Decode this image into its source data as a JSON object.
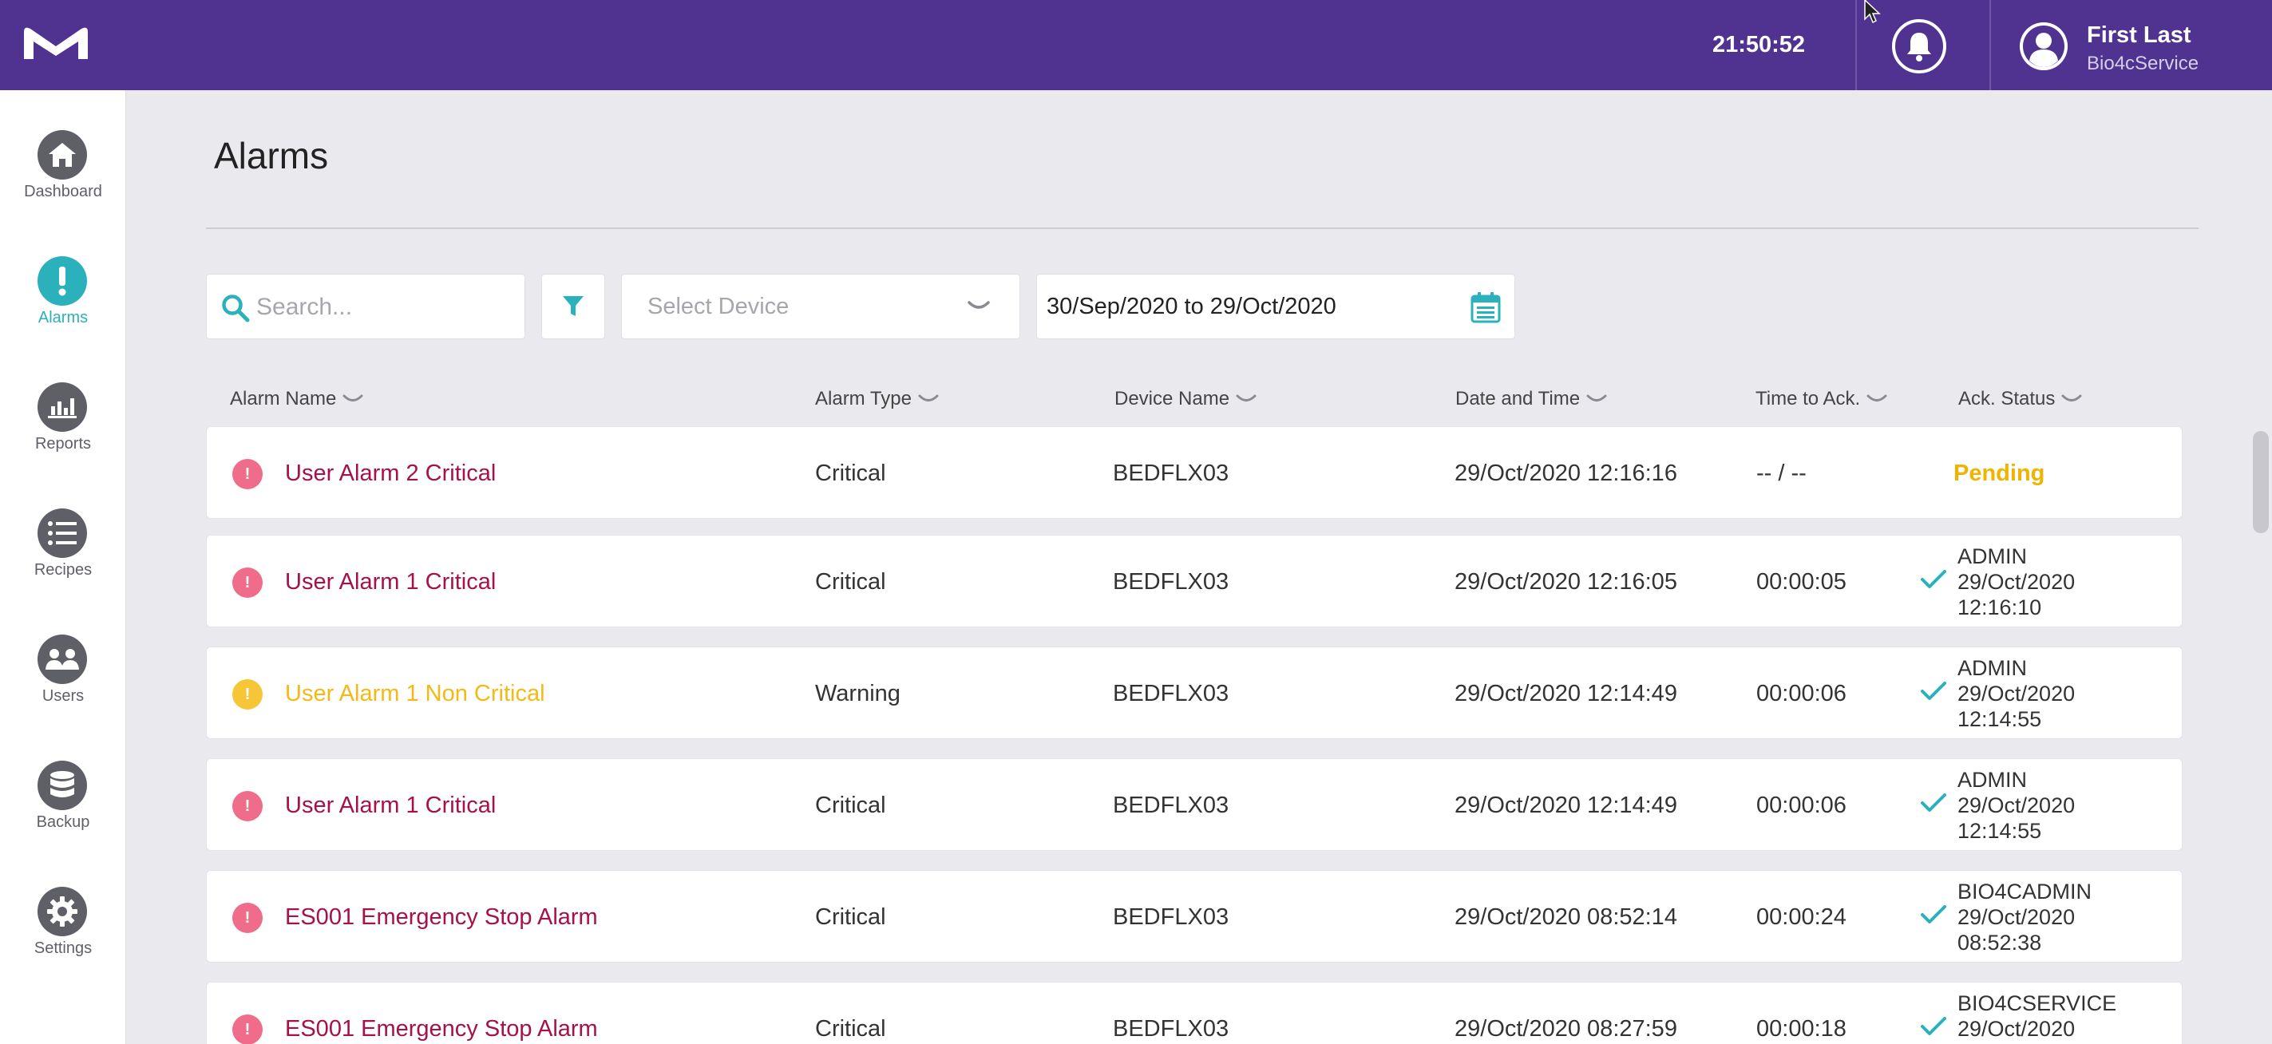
{
  "topbar": {
    "clock": "21:50:52",
    "user": {
      "name": "First Last",
      "role": "Bio4cService"
    }
  },
  "colors": {
    "brand_purple": "#503291",
    "accent_teal": "#2bb1bb",
    "critical": "#a6114a",
    "critical_dot": "#ef6d8a",
    "warning": "#f5b915",
    "warning_dot": "#f7c636",
    "pending": "#f0b400"
  },
  "sidebar": {
    "items": [
      {
        "label": "Dashboard",
        "icon": "home-icon",
        "active": false
      },
      {
        "label": "Alarms",
        "icon": "alert-icon",
        "active": true
      },
      {
        "label": "Reports",
        "icon": "chart-icon",
        "active": false
      },
      {
        "label": "Recipes",
        "icon": "list-icon",
        "active": false
      },
      {
        "label": "Users",
        "icon": "users-icon",
        "active": false
      },
      {
        "label": "Backup",
        "icon": "database-icon",
        "active": false
      },
      {
        "label": "Settings",
        "icon": "gear-icon",
        "active": false
      }
    ]
  },
  "page": {
    "title": "Alarms"
  },
  "filters": {
    "search_placeholder": "Search...",
    "device_placeholder": "Select Device",
    "date_range": "30/Sep/2020 to 29/Oct/2020"
  },
  "table": {
    "columns": [
      "Alarm Name",
      "Alarm Type",
      "Device Name",
      "Date and Time",
      "Time to Ack.",
      "Ack. Status"
    ],
    "rows": [
      {
        "severity": "critical",
        "name": "User Alarm 2 Critical",
        "type": "Critical",
        "device": "BEDFLX03",
        "datetime": "29/Oct/2020 12:16:16",
        "time_to_ack": "-- / --",
        "ack_status": "Pending",
        "ack_user": "",
        "ack_date": "",
        "ack_time": ""
      },
      {
        "severity": "critical",
        "name": "User Alarm 1 Critical",
        "type": "Critical",
        "device": "BEDFLX03",
        "datetime": "29/Oct/2020 12:16:05",
        "time_to_ack": "00:00:05",
        "ack_status": "",
        "ack_user": "ADMIN",
        "ack_date": "29/Oct/2020",
        "ack_time": "12:16:10"
      },
      {
        "severity": "warning",
        "name": "User Alarm 1 Non Critical",
        "type": "Warning",
        "device": "BEDFLX03",
        "datetime": "29/Oct/2020 12:14:49",
        "time_to_ack": "00:00:06",
        "ack_status": "",
        "ack_user": "ADMIN",
        "ack_date": "29/Oct/2020",
        "ack_time": "12:14:55"
      },
      {
        "severity": "critical",
        "name": "User Alarm 1 Critical",
        "type": "Critical",
        "device": "BEDFLX03",
        "datetime": "29/Oct/2020 12:14:49",
        "time_to_ack": "00:00:06",
        "ack_status": "",
        "ack_user": "ADMIN",
        "ack_date": "29/Oct/2020",
        "ack_time": "12:14:55"
      },
      {
        "severity": "critical",
        "name": "ES001 Emergency Stop Alarm",
        "type": "Critical",
        "device": "BEDFLX03",
        "datetime": "29/Oct/2020 08:52:14",
        "time_to_ack": "00:00:24",
        "ack_status": "",
        "ack_user": "BIO4CADMIN",
        "ack_date": "29/Oct/2020",
        "ack_time": "08:52:38"
      },
      {
        "severity": "critical",
        "name": "ES001 Emergency Stop Alarm",
        "type": "Critical",
        "device": "BEDFLX03",
        "datetime": "29/Oct/2020 08:27:59",
        "time_to_ack": "00:00:18",
        "ack_status": "",
        "ack_user": "BIO4CSERVICE",
        "ack_date": "29/Oct/2020",
        "ack_time": ""
      }
    ]
  }
}
